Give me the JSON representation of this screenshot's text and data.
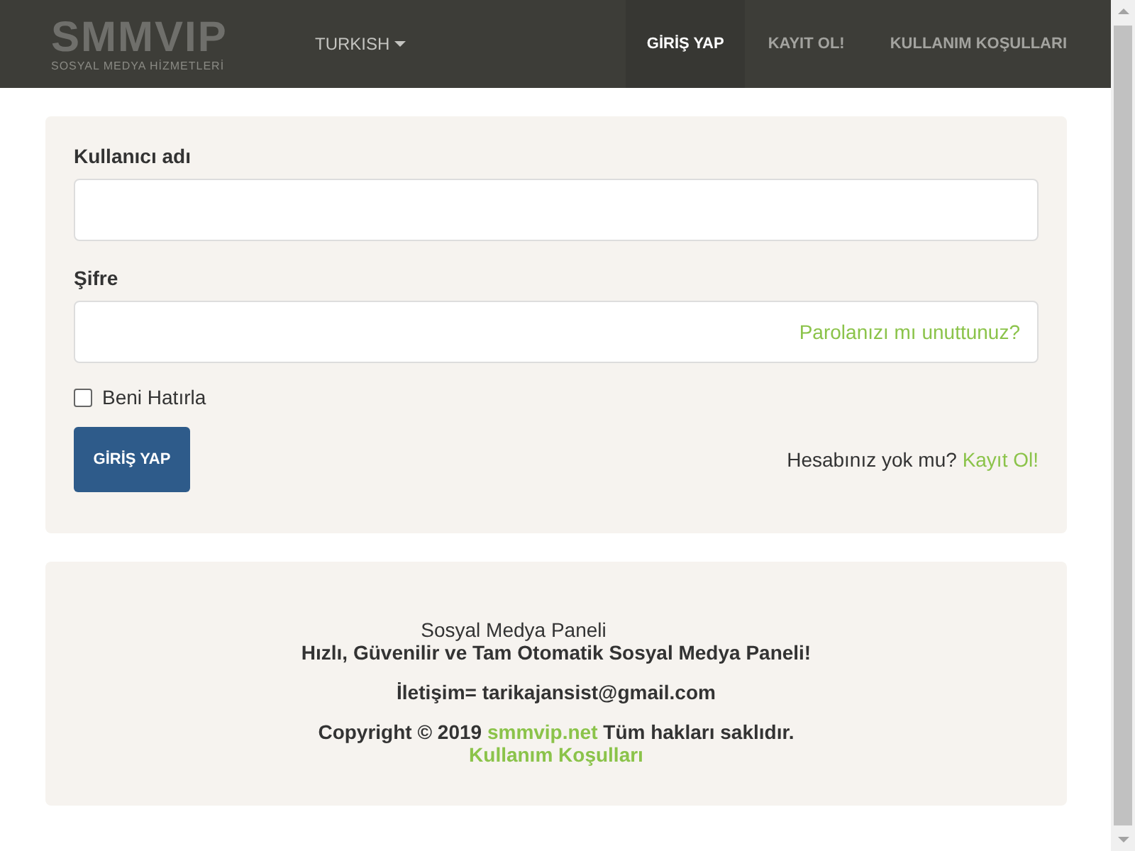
{
  "navbar": {
    "logo": "SMMVIP",
    "logo_tagline": "SOSYAL MEDYA HİZMETLERİ",
    "language": "TURKISH",
    "links": [
      {
        "label": "GİRİŞ YAP",
        "selected": true
      },
      {
        "label": "KAYIT OL!",
        "selected": false
      },
      {
        "label": "KULLANIM KOŞULLARI",
        "selected": false
      }
    ]
  },
  "login_form": {
    "username_label": "Kullanıcı adı",
    "password_label": "Şifre",
    "forgot_link": "Parolanızı mı unuttunuz?",
    "remember": {
      "label": "Beni Hatırla",
      "checked": false
    },
    "submit": "GİRİŞ YAP",
    "signup_prompt": "Hesabınız yok mu?",
    "signup_link": "Kayıt Ol!"
  },
  "footer": {
    "title": "Sosyal Medya Paneli",
    "slogan": "Hızlı, Güvenilir ve Tam Otomatik Sosyal Medya Paneli!",
    "contact": "İletişim= tarikajansist@gmail.com",
    "copyright_before": "Copyright © 2019",
    "copyright_link": "smmvip.net",
    "copyright_after": "Tüm hakları saklıdır.",
    "terms_link": "Kullanım Koşulları"
  }
}
